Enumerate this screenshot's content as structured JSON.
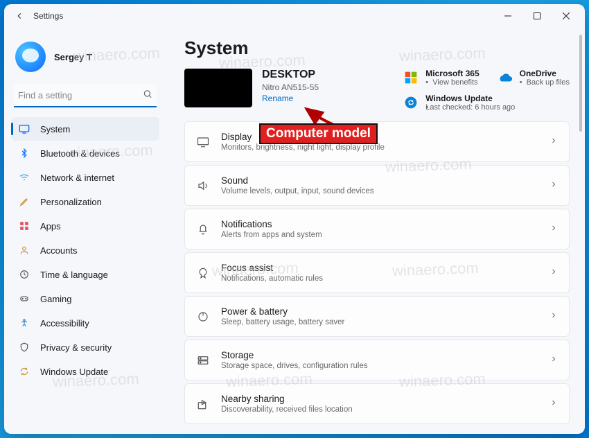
{
  "window": {
    "title": "Settings"
  },
  "profile": {
    "name": "Sergey T"
  },
  "search": {
    "placeholder": "Find a setting"
  },
  "sidebar": {
    "items": [
      {
        "label": "System",
        "icon": "system",
        "selected": true
      },
      {
        "label": "Bluetooth & devices",
        "icon": "bluetooth",
        "selected": false
      },
      {
        "label": "Network & internet",
        "icon": "network",
        "selected": false
      },
      {
        "label": "Personalization",
        "icon": "personalization",
        "selected": false
      },
      {
        "label": "Apps",
        "icon": "apps",
        "selected": false
      },
      {
        "label": "Accounts",
        "icon": "accounts",
        "selected": false
      },
      {
        "label": "Time & language",
        "icon": "timelang",
        "selected": false
      },
      {
        "label": "Gaming",
        "icon": "gaming",
        "selected": false
      },
      {
        "label": "Accessibility",
        "icon": "accessibility",
        "selected": false
      },
      {
        "label": "Privacy & security",
        "icon": "privacy",
        "selected": false
      },
      {
        "label": "Windows Update",
        "icon": "update",
        "selected": false
      }
    ]
  },
  "page": {
    "title": "System"
  },
  "device": {
    "name": "DESKTOP",
    "model": "Nitro AN515-55",
    "rename": "Rename"
  },
  "quicklinks": {
    "m365": {
      "title": "Microsoft 365",
      "sub": "View benefits"
    },
    "onedrive": {
      "title": "OneDrive",
      "sub": "Back up files"
    },
    "update": {
      "title": "Windows Update",
      "sub": "Last checked: 6 hours ago"
    }
  },
  "tiles": [
    {
      "icon": "display",
      "title": "Display",
      "sub": "Monitors, brightness, night light, display profile"
    },
    {
      "icon": "sound",
      "title": "Sound",
      "sub": "Volume levels, output, input, sound devices"
    },
    {
      "icon": "notifications",
      "title": "Notifications",
      "sub": "Alerts from apps and system"
    },
    {
      "icon": "focus",
      "title": "Focus assist",
      "sub": "Notifications, automatic rules"
    },
    {
      "icon": "power",
      "title": "Power & battery",
      "sub": "Sleep, battery usage, battery saver"
    },
    {
      "icon": "storage",
      "title": "Storage",
      "sub": "Storage space, drives, configuration rules"
    },
    {
      "icon": "share",
      "title": "Nearby sharing",
      "sub": "Discoverability, received files location"
    }
  ],
  "annotation": {
    "label": "Computer model"
  },
  "watermark": "winaero.com"
}
